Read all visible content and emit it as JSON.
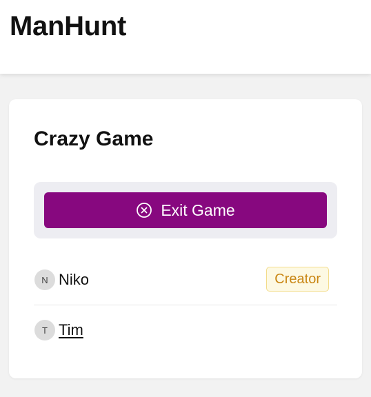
{
  "header": {
    "title": "ManHunt"
  },
  "game": {
    "title": "Crazy Game",
    "exit_button": {
      "label": "Exit Game",
      "icon": "close-circle-icon",
      "color": "#87087f"
    },
    "players": [
      {
        "initial": "N",
        "name": "Niko",
        "badge": "Creator"
      },
      {
        "initial": "T",
        "name": "Tim"
      }
    ]
  }
}
